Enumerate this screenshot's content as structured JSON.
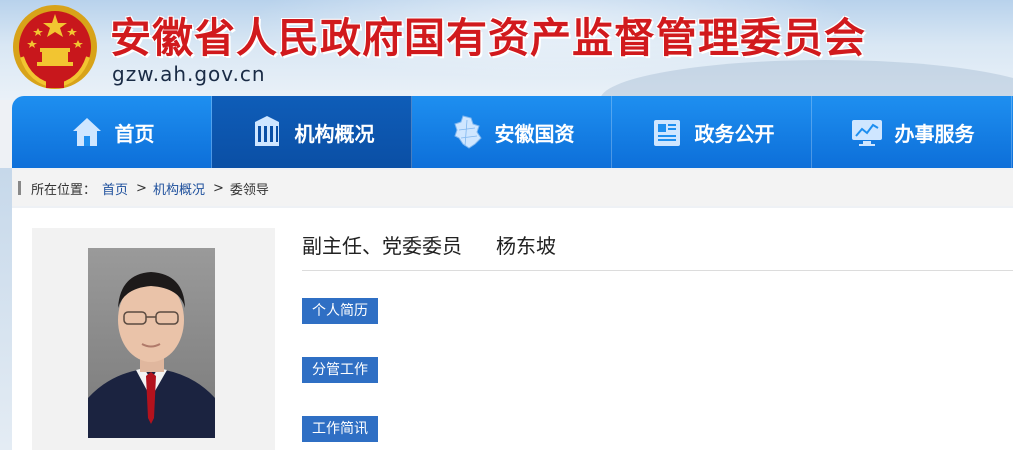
{
  "header": {
    "title": "安徽省人民政府国有资产监督管理委员会",
    "domain": "gzw.ah.gov.cn",
    "emblem_icon": "national-emblem-icon"
  },
  "nav": {
    "items": [
      {
        "label": "首页",
        "icon": "home-icon",
        "active": false
      },
      {
        "label": "机构概况",
        "icon": "building-icon",
        "active": true
      },
      {
        "label": "安徽国资",
        "icon": "anhui-map-icon",
        "active": false
      },
      {
        "label": "政务公开",
        "icon": "news-icon",
        "active": false
      },
      {
        "label": "办事服务",
        "icon": "chart-monitor-icon",
        "active": false
      }
    ]
  },
  "breadcrumb": {
    "prefix": "所在位置：",
    "items": [
      "首页",
      "机构概况"
    ],
    "separator": ">",
    "current": "委领导"
  },
  "profile": {
    "position": "副主任、党委委员",
    "name": "杨东坡",
    "tabs": [
      "个人简历",
      "分管工作",
      "工作简讯"
    ]
  },
  "colors": {
    "title_red": "#d11a1d",
    "nav_blue": "#0d6fd9",
    "nav_active": "#0a4fa5",
    "tag_blue": "#2f6fc4"
  }
}
